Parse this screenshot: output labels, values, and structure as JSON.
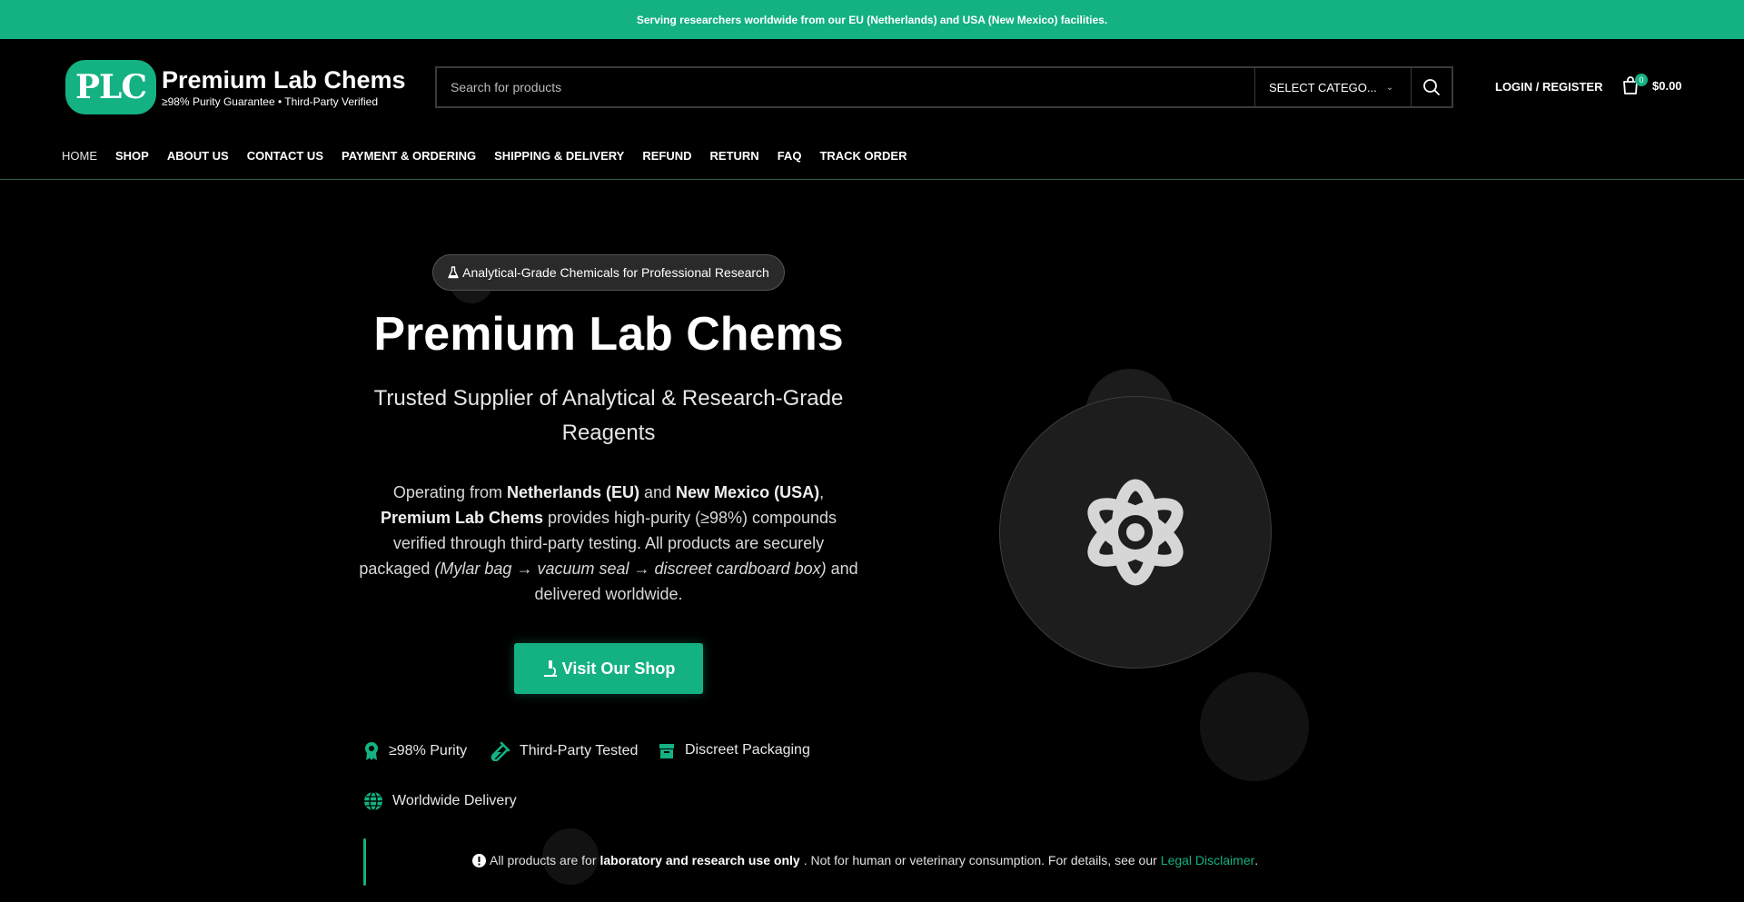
{
  "topbar": {
    "text": "Serving researchers worldwide from our EU (Netherlands) and USA (New Mexico) facilities."
  },
  "logo": {
    "badge": "PLC",
    "name": "Premium Lab Chems",
    "tagline": "≥98% Purity Guarantee  • Third-Party Verified"
  },
  "search": {
    "placeholder": "Search for products",
    "category": "SELECT CATEGO..."
  },
  "account": {
    "login_label": "LOGIN / REGISTER"
  },
  "cart": {
    "count": "0",
    "total": "$0.00"
  },
  "nav": {
    "items": [
      "HOME",
      "SHOP",
      "ABOUT US",
      "CONTACT US",
      "PAYMENT & ORDERING",
      "SHIPPING & DELIVERY",
      "REFUND",
      "RETURN",
      "FAQ",
      "TRACK ORDER"
    ]
  },
  "hero": {
    "pill": "Analytical-Grade Chemicals for Professional Research",
    "title": "Premium Lab Chems",
    "subtitle": "Trusted Supplier of Analytical & Research-Grade Reagents",
    "desc": {
      "p1": "Operating from ",
      "loc1": "Netherlands (EU)",
      "p2": " and ",
      "loc2": "New Mexico (USA)",
      "p3": ",",
      "brand": "Premium Lab Chems",
      "p4": " provides high-purity (≥98%) compounds verified through third-party testing. All products are securely packaged ",
      "pack": "(Mylar bag → vacuum seal → discreet cardboard box)",
      "p5": " and delivered worldwide."
    },
    "cta": "Visit Our Shop",
    "features": [
      "≥98% Purity",
      "Third-Party Tested",
      "Discreet Packaging",
      "Worldwide Delivery"
    ]
  },
  "disclaimer": {
    "p1": "All products are for",
    "bold": "laboratory and research use only",
    "p2": ". Not for human or veterinary consumption. For details, see our",
    "link": "Legal Disclaimer",
    "p3": "."
  },
  "colors": {
    "accent": "#14b183",
    "background": "#000000"
  }
}
